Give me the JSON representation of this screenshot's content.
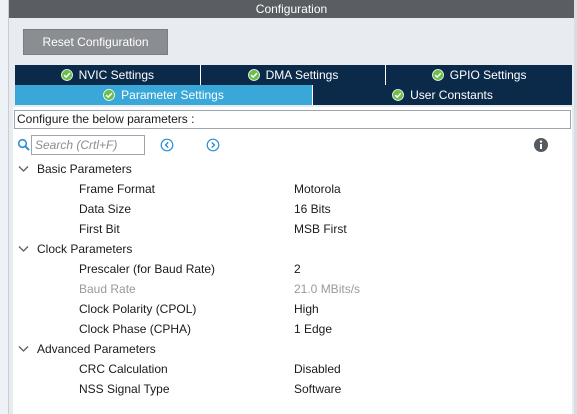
{
  "header": {
    "title": "Configuration"
  },
  "toolbar": {
    "reset_label": "Reset Configuration"
  },
  "tabs_row1": [
    {
      "label": "NVIC Settings",
      "icon": "check-circle-icon"
    },
    {
      "label": "DMA Settings",
      "icon": "check-circle-icon"
    },
    {
      "label": "GPIO Settings",
      "icon": "check-circle-icon"
    }
  ],
  "tabs_row2": [
    {
      "label": "Parameter Settings",
      "icon": "check-circle-icon",
      "active": true
    },
    {
      "label": "User Constants",
      "icon": "check-circle-icon",
      "active": false
    }
  ],
  "description": "Configure the below parameters :",
  "search": {
    "placeholder": "Search (Crtl+F)"
  },
  "groups": [
    {
      "label": "Basic Parameters",
      "params": [
        {
          "name": "Frame Format",
          "value": "Motorola"
        },
        {
          "name": "Data Size",
          "value": "16 Bits"
        },
        {
          "name": "First Bit",
          "value": "MSB First"
        }
      ]
    },
    {
      "label": "Clock Parameters",
      "params": [
        {
          "name": "Prescaler (for Baud Rate)",
          "value": "2"
        },
        {
          "name": "Baud Rate",
          "value": "21.0 MBits/s",
          "disabled": true
        },
        {
          "name": "Clock Polarity (CPOL)",
          "value": "High"
        },
        {
          "name": "Clock Phase (CPHA)",
          "value": "1 Edge"
        }
      ]
    },
    {
      "label": "Advanced Parameters",
      "params": [
        {
          "name": "CRC Calculation",
          "value": "Disabled"
        },
        {
          "name": "NSS Signal Type",
          "value": "Software"
        }
      ]
    }
  ],
  "colors": {
    "title_bar": "#5a5e63",
    "tab_inactive": "#0b2a4a",
    "tab_active": "#39a7d8",
    "check_green": "#6cc04a",
    "nav_blue": "#2a8fd6"
  }
}
